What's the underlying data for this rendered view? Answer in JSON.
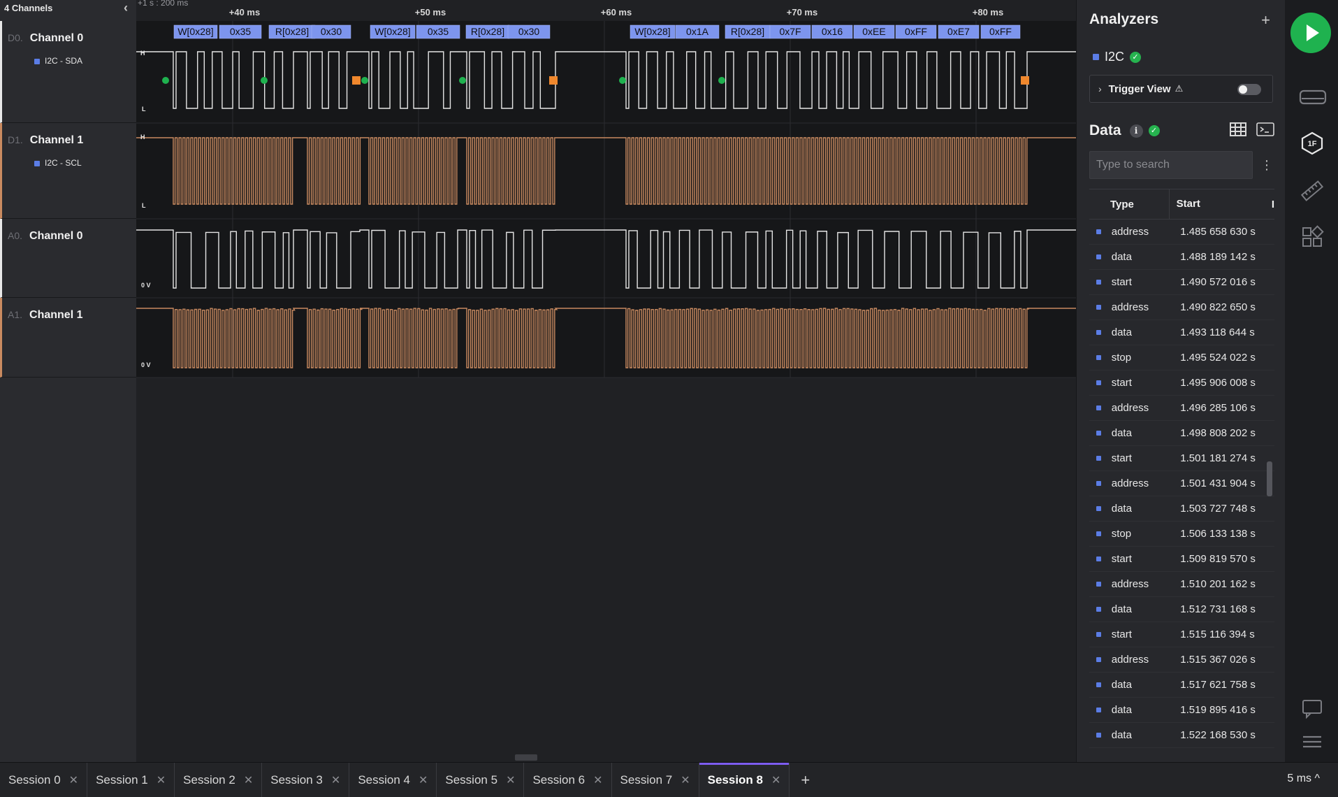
{
  "left": {
    "header": "4 Channels",
    "channels": [
      {
        "tag": "D0.",
        "name": "Channel 0",
        "sub": "I2C - SDA"
      },
      {
        "tag": "D1.",
        "name": "Channel 1",
        "sub": "I2C - SCL"
      },
      {
        "tag": "A0.",
        "name": "Channel 0",
        "sub": ""
      },
      {
        "tag": "A1.",
        "name": "Channel 1",
        "sub": ""
      }
    ]
  },
  "timeline": {
    "scale_label": "+1 s : 200 ms",
    "markers": [
      "+40 ms",
      "+50 ms",
      "+60 ms",
      "+70 ms",
      "+80 ms"
    ],
    "level_high": "H",
    "level_low": "L",
    "zero_volt": "0 V"
  },
  "decodes": [
    "W[0x28]",
    "0x35",
    "R[0x28]",
    "0x30",
    "W[0x28]",
    "0x35",
    "R[0x28]",
    "0x30",
    "W[0x28]",
    "0x1A",
    "R[0x28]",
    "0x7F",
    "0x16",
    "0xEE",
    "0xFF",
    "0xE7",
    "0xFF"
  ],
  "panel": {
    "analyzers_title": "Analyzers",
    "add": "+",
    "analyzer_name": "I2C",
    "trigger_label": "Trigger View",
    "trigger_enabled": false,
    "data_title": "Data",
    "search_placeholder": "Type to search",
    "col_type": "Type",
    "col_start": "Start",
    "col_more": "I",
    "rows": [
      {
        "type": "address",
        "start": "1.485 658 630 s"
      },
      {
        "type": "data",
        "start": "1.488 189 142 s"
      },
      {
        "type": "start",
        "start": "1.490 572 016 s"
      },
      {
        "type": "address",
        "start": "1.490 822 650 s"
      },
      {
        "type": "data",
        "start": "1.493 118 644 s"
      },
      {
        "type": "stop",
        "start": "1.495 524 022 s"
      },
      {
        "type": "start",
        "start": "1.495 906 008 s"
      },
      {
        "type": "address",
        "start": "1.496 285 106 s"
      },
      {
        "type": "data",
        "start": "1.498 808 202 s"
      },
      {
        "type": "start",
        "start": "1.501 181 274 s"
      },
      {
        "type": "address",
        "start": "1.501 431 904 s"
      },
      {
        "type": "data",
        "start": "1.503 727 748 s"
      },
      {
        "type": "stop",
        "start": "1.506 133 138 s"
      },
      {
        "type": "start",
        "start": "1.509 819 570 s"
      },
      {
        "type": "address",
        "start": "1.510 201 162 s"
      },
      {
        "type": "data",
        "start": "1.512 731 168 s"
      },
      {
        "type": "start",
        "start": "1.515 116 394 s"
      },
      {
        "type": "address",
        "start": "1.515 367 026 s"
      },
      {
        "type": "data",
        "start": "1.517 621 758 s"
      },
      {
        "type": "data",
        "start": "1.519 895 416 s"
      },
      {
        "type": "data",
        "start": "1.522 168 530 s"
      }
    ]
  },
  "tabs": [
    {
      "label": "Session 0",
      "active": false
    },
    {
      "label": "Session 1",
      "active": false
    },
    {
      "label": "Session 2",
      "active": false
    },
    {
      "label": "Session 3",
      "active": false
    },
    {
      "label": "Session 4",
      "active": false
    },
    {
      "label": "Session 5",
      "active": false
    },
    {
      "label": "Session 6",
      "active": false
    },
    {
      "label": "Session 7",
      "active": false
    },
    {
      "label": "Session 8",
      "active": true
    }
  ],
  "zoom": "5 ms ^",
  "colors": {
    "accent_green": "#1fb24f",
    "analyzer_blue": "#5b7de6",
    "scl_orange": "#c98a60",
    "tab_accent": "#7d5cf0"
  }
}
